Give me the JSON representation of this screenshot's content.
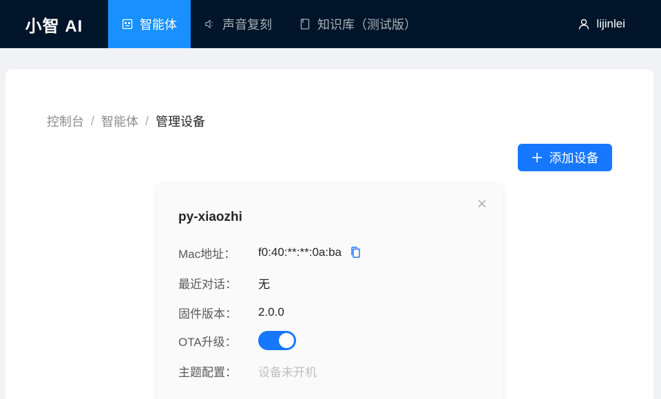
{
  "app": {
    "logo": "小智 AI"
  },
  "nav": [
    {
      "label": "智能体",
      "icon": "robot-icon",
      "active": true
    },
    {
      "label": "声音复刻",
      "icon": "speaker-icon",
      "active": false
    },
    {
      "label": "知识库（测试版）",
      "icon": "book-icon",
      "active": false
    }
  ],
  "user": {
    "name": "lijinlei",
    "icon": "user-icon"
  },
  "breadcrumb": {
    "items": [
      "控制台",
      "智能体"
    ],
    "current": "管理设备",
    "separator": "/"
  },
  "toolbar": {
    "add_label": "添加设备"
  },
  "device": {
    "name": "py-xiaozhi",
    "mac_label": "Mac地址：",
    "mac_value": "f0:40:**:**:0a:ba",
    "last_chat_label": "最近对话：",
    "last_chat_value": "无",
    "firmware_label": "固件版本：",
    "firmware_value": "2.0.0",
    "ota_label": "OTA升级：",
    "ota_enabled": true,
    "theme_label": "主题配置：",
    "theme_value": "设备未开机"
  },
  "colors": {
    "primary": "#1677ff",
    "header": "#001529"
  }
}
